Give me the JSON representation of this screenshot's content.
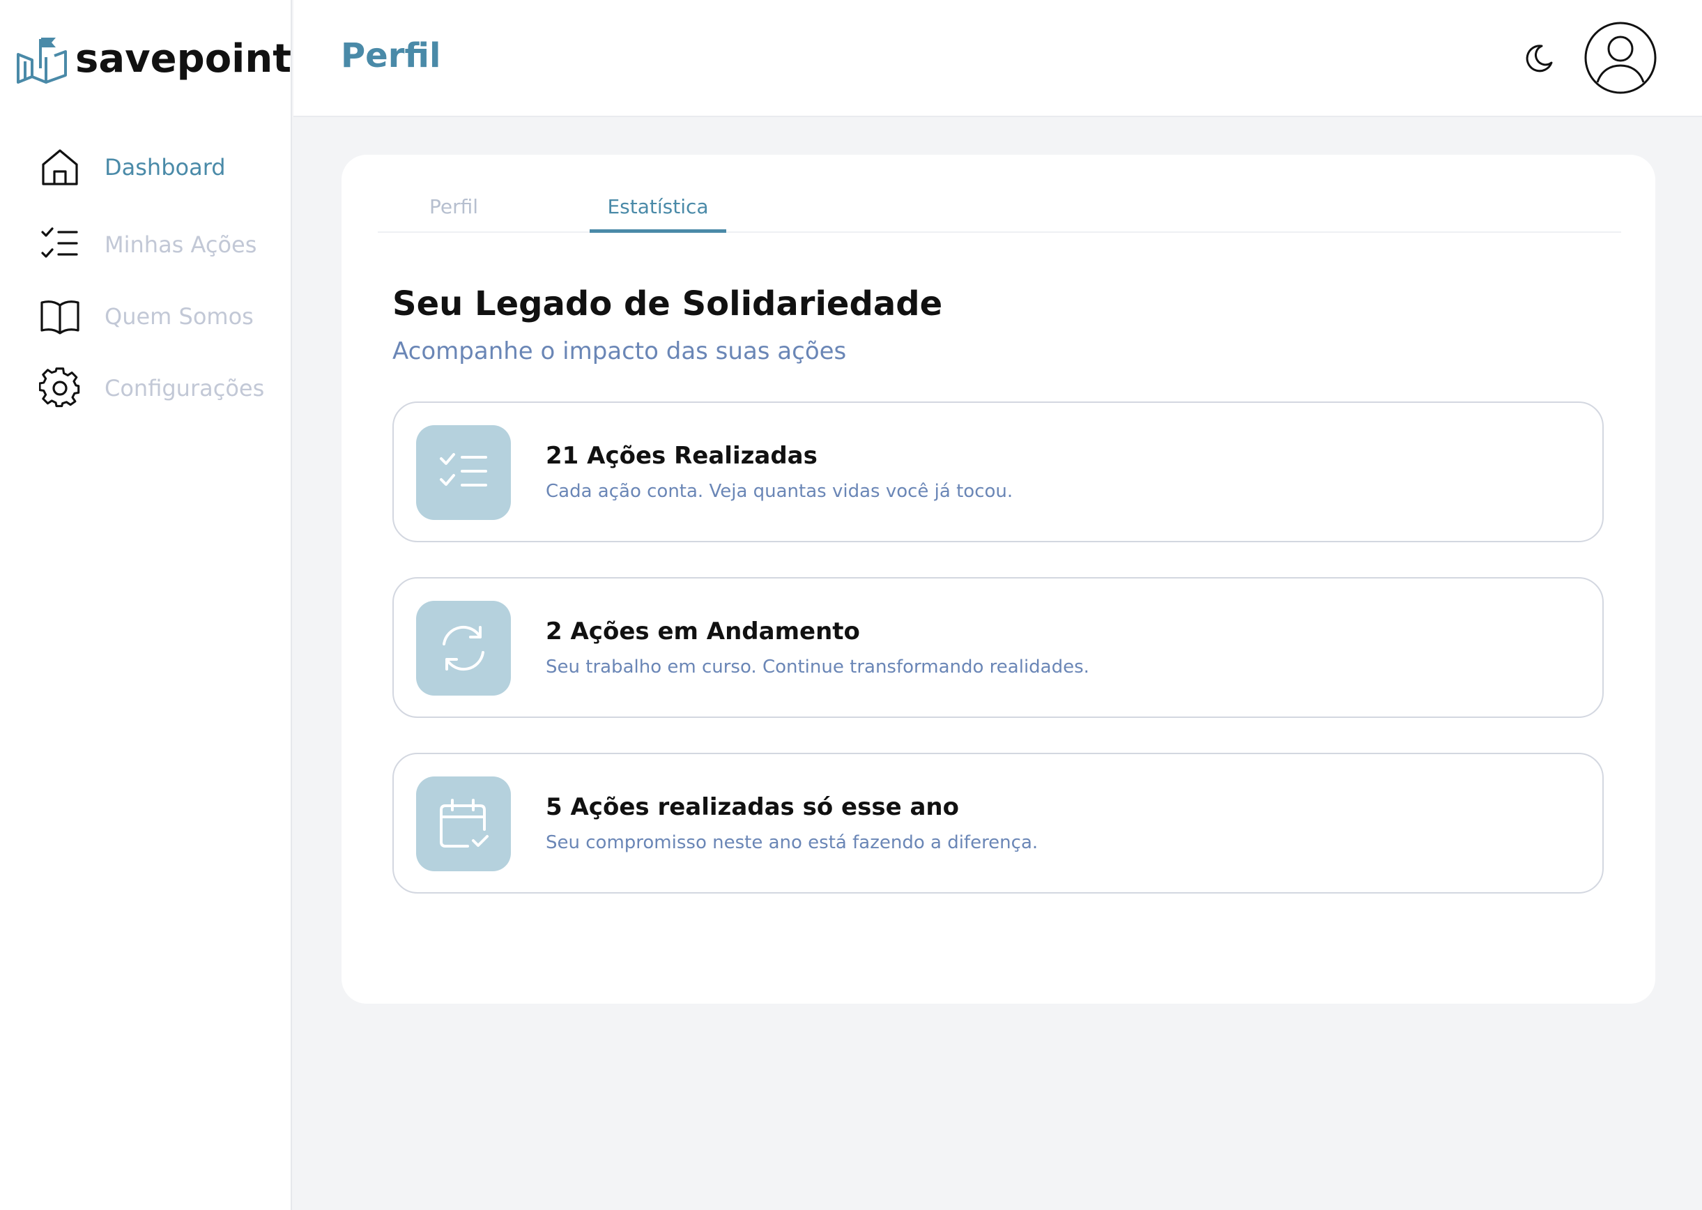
{
  "app": {
    "name": "savepoint"
  },
  "sidebar": {
    "items": [
      {
        "label": "Dashboard",
        "icon": "home-icon"
      },
      {
        "label": "Minhas Ações",
        "icon": "checklist-icon"
      },
      {
        "label": "Quem Somos",
        "icon": "book-icon"
      },
      {
        "label": "Configurações",
        "icon": "gear-icon"
      }
    ]
  },
  "header": {
    "title": "Perfil",
    "theme_icon": "moon-icon",
    "avatar_icon": "user-avatar-icon"
  },
  "tabs": [
    {
      "label": "Perfil",
      "active": false
    },
    {
      "label": "Estatística",
      "active": true
    }
  ],
  "main": {
    "title": "Seu Legado de Solidariedade",
    "subtitle": "Acompanhe o impacto das suas ações",
    "stats": [
      {
        "title": "21 Ações Realizadas",
        "description": "Cada ação conta. Veja quantas vidas você já tocou.",
        "icon": "checklist-icon"
      },
      {
        "title": "2 Ações em Andamento",
        "description": "Seu trabalho em curso. Continue transformando realidades.",
        "icon": "refresh-icon"
      },
      {
        "title": "5 Ações realizadas só esse ano",
        "description": "Seu compromisso neste ano está fazendo a diferença.",
        "icon": "calendar-check-icon"
      }
    ]
  },
  "colors": {
    "accent": "#4a8aa8",
    "muted_nav": "#c2c8d6",
    "subtitle": "#6a86b6",
    "icon_tile": "#b5d1dd",
    "background": "#f3f4f6"
  }
}
